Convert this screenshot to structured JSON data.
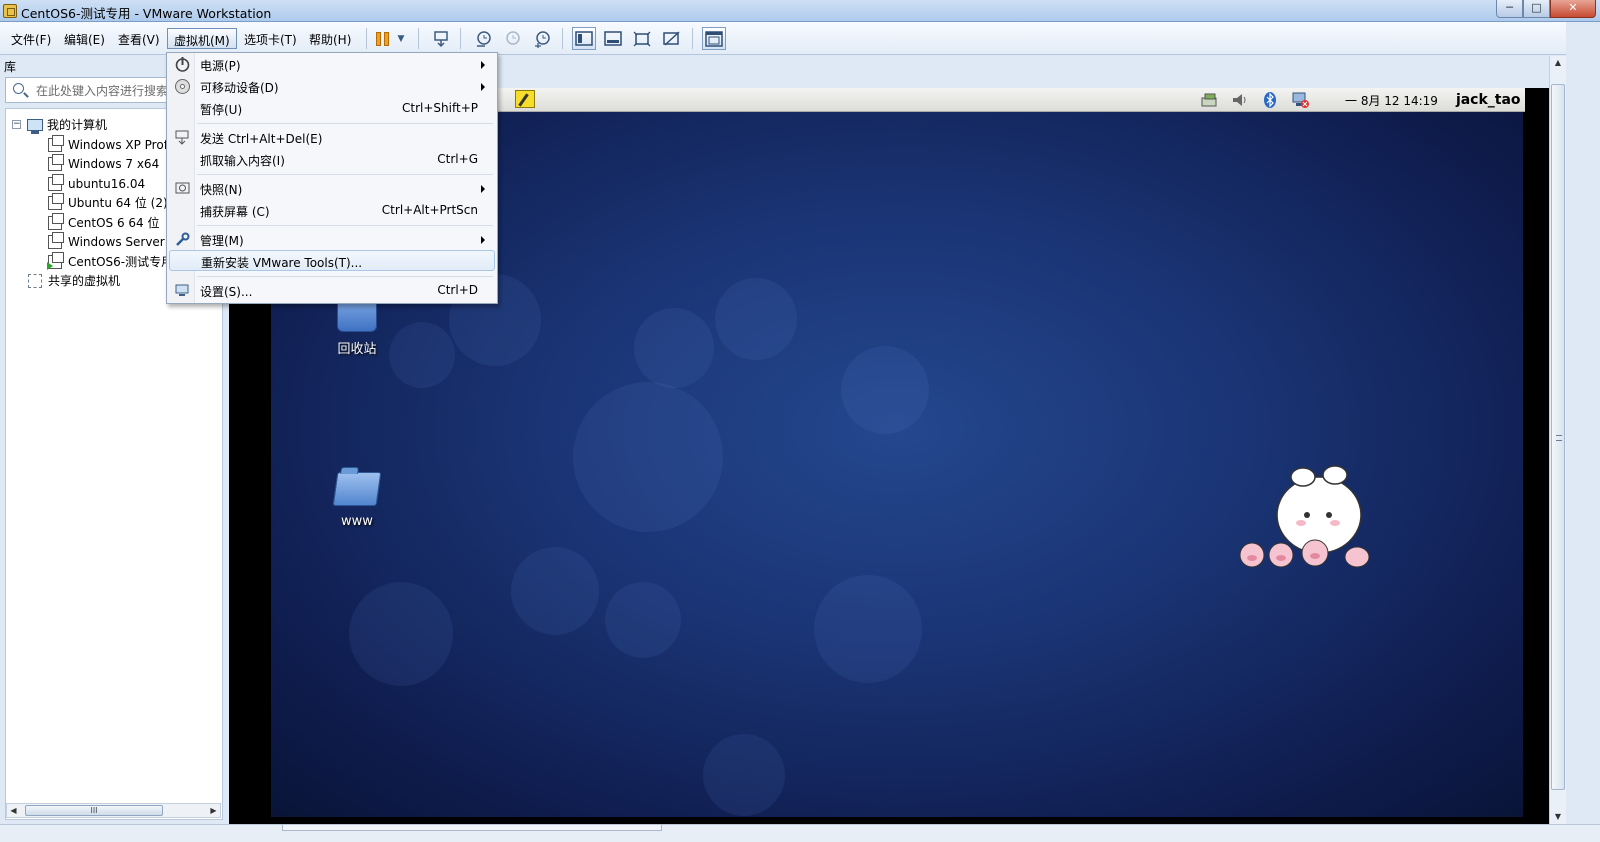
{
  "window": {
    "title": "CentOS6-测试专用 - VMware Workstation",
    "controls": {
      "minimize": "─",
      "maximize": "□",
      "close": "✕"
    }
  },
  "menubar": {
    "items": [
      "文件(F)",
      "编辑(E)",
      "查看(V)",
      "虚拟机(M)",
      "选项卡(T)",
      "帮助(H)"
    ],
    "active": "虚拟机(M)"
  },
  "toolbar": {
    "buttons": [
      "pause-icon",
      "chevron-down-icon",
      "send-ctrl-alt-del-icon",
      "snapshot-icon",
      "revert-snapshot-icon",
      "snapshot-manager-icon",
      "library-view-icon",
      "thumbnail-view-icon",
      "fullscreen-icon",
      "unity-icon",
      "console-view-icon"
    ]
  },
  "library": {
    "header": "库",
    "search_placeholder": "在此处键入内容进行搜索",
    "tree": {
      "root": "我的计算机",
      "vms": [
        {
          "name": "Windows XP Professional",
          "running": false
        },
        {
          "name": "Windows 7 x64",
          "running": false
        },
        {
          "name": "ubuntu16.04",
          "running": false
        },
        {
          "name": "Ubuntu 64 位 (2)",
          "running": false
        },
        {
          "name": "CentOS 6 64 位",
          "running": false
        },
        {
          "name": "Windows Server 2008",
          "running": false
        },
        {
          "name": "CentOS6-测试专用",
          "running": true
        }
      ],
      "shared": "共享的虚拟机"
    },
    "scroll_grip": "III"
  },
  "vm_menu": {
    "items": [
      {
        "label": "电源(P)",
        "shortcut": "",
        "submenu": true,
        "icon": "power-icon"
      },
      {
        "label": "可移动设备(D)",
        "shortcut": "",
        "submenu": true,
        "icon": "disc-icon"
      },
      {
        "label": "暂停(U)",
        "shortcut": "Ctrl+Shift+P",
        "submenu": false,
        "icon": ""
      },
      {
        "label": "发送 Ctrl+Alt+Del(E)",
        "shortcut": "",
        "submenu": false,
        "icon": "keyboard-icon"
      },
      {
        "label": "抓取输入内容(I)",
        "shortcut": "Ctrl+G",
        "submenu": false,
        "icon": ""
      },
      {
        "label": "快照(N)",
        "shortcut": "",
        "submenu": true,
        "icon": "snapshot-icon"
      },
      {
        "label": "捕获屏幕 (C)",
        "shortcut": "Ctrl+Alt+PrtScn",
        "submenu": false,
        "icon": ""
      },
      {
        "label": "管理(M)",
        "shortcut": "",
        "submenu": true,
        "icon": "wrench-icon"
      },
      {
        "label": "重新安装 VMware Tools(T)...",
        "shortcut": "",
        "submenu": false,
        "icon": "",
        "highlighted": true
      },
      {
        "label": "设置(S)...",
        "shortcut": "Ctrl+D",
        "submenu": false,
        "icon": "settings-icon"
      }
    ]
  },
  "guest": {
    "panel": {
      "clock": "一 8月 12 14:19",
      "user": "jack_tao",
      "tray_icons": [
        "network-icon",
        "volume-icon",
        "bluetooth-icon",
        "network-disconnected-icon"
      ]
    },
    "desktop_icons": [
      {
        "label": "回收站",
        "icon": "trash-icon"
      },
      {
        "label": "www",
        "icon": "folder-icon"
      }
    ]
  },
  "colors": {
    "desktop_bg": "#1a3474",
    "titlebar": "#bad3ee",
    "menu_highlight": "#e1ecf8"
  }
}
